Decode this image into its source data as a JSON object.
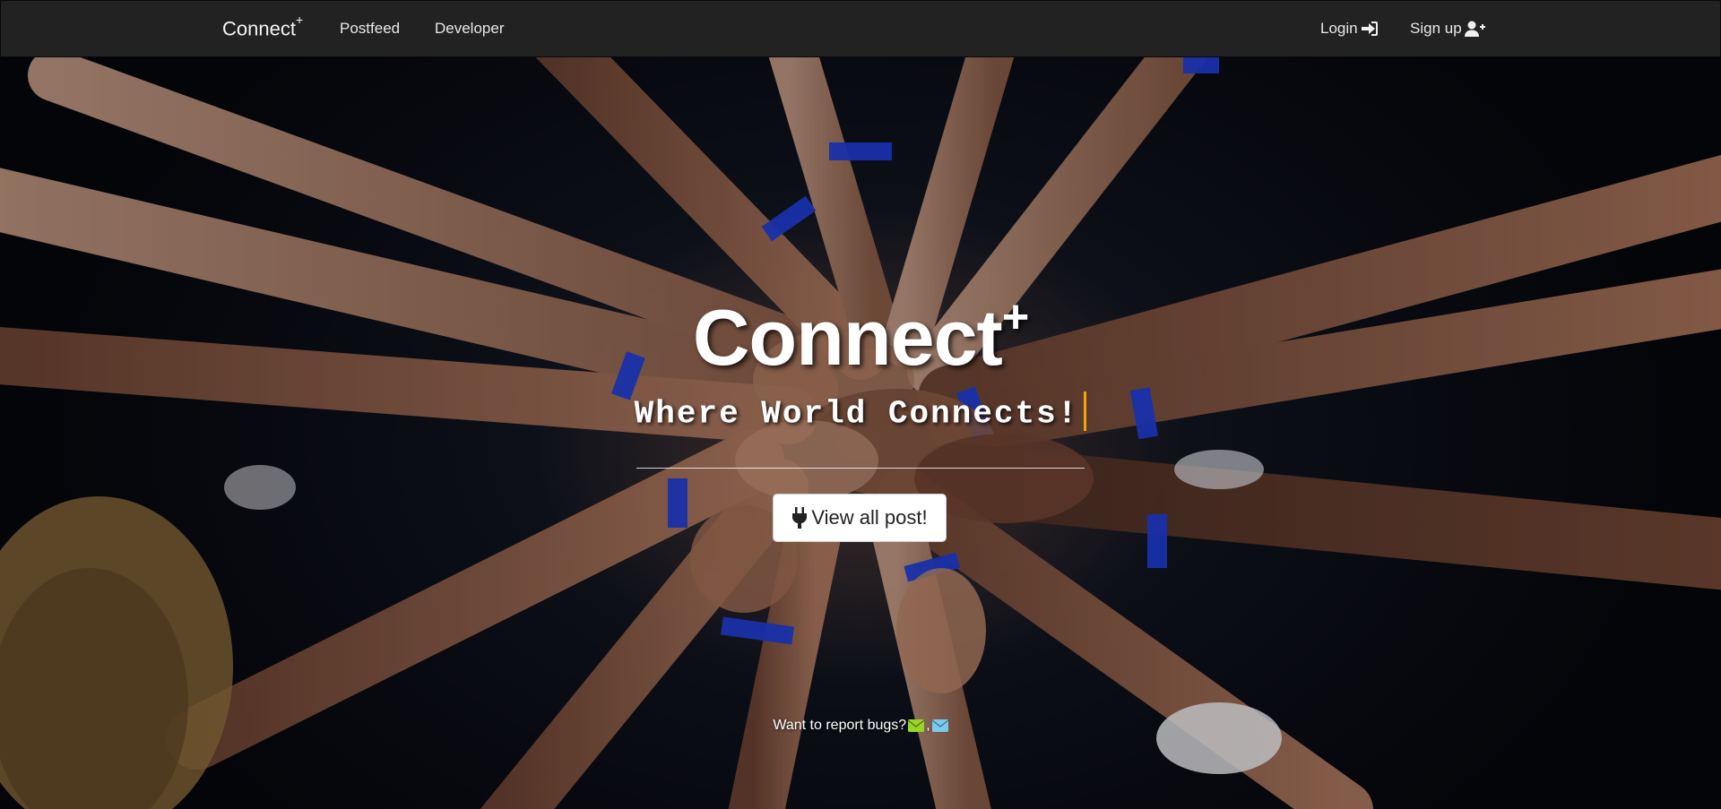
{
  "navbar": {
    "brand": "Connect",
    "brand_sup": "+",
    "links": {
      "postfeed": "Postfeed",
      "developer": "Developer",
      "login": "Login",
      "signup": "Sign up"
    },
    "icons": {
      "login": "sign-in-icon",
      "signup": "user-plus-icon"
    }
  },
  "hero": {
    "title": "Connect",
    "title_sup": "+",
    "tagline": "Where World Connects!",
    "button_label": "View all post!",
    "button_icon": "plug-icon"
  },
  "footer": {
    "report_text": "Want to report bugs?",
    "separator": ",",
    "icons": [
      "envelope-green-icon",
      "envelope-blue-icon"
    ]
  },
  "colors": {
    "navbar_bg": "#222222",
    "cursor": "#f0a30a",
    "mail_green": "#9ad42a",
    "mail_blue": "#7ec8ee"
  }
}
